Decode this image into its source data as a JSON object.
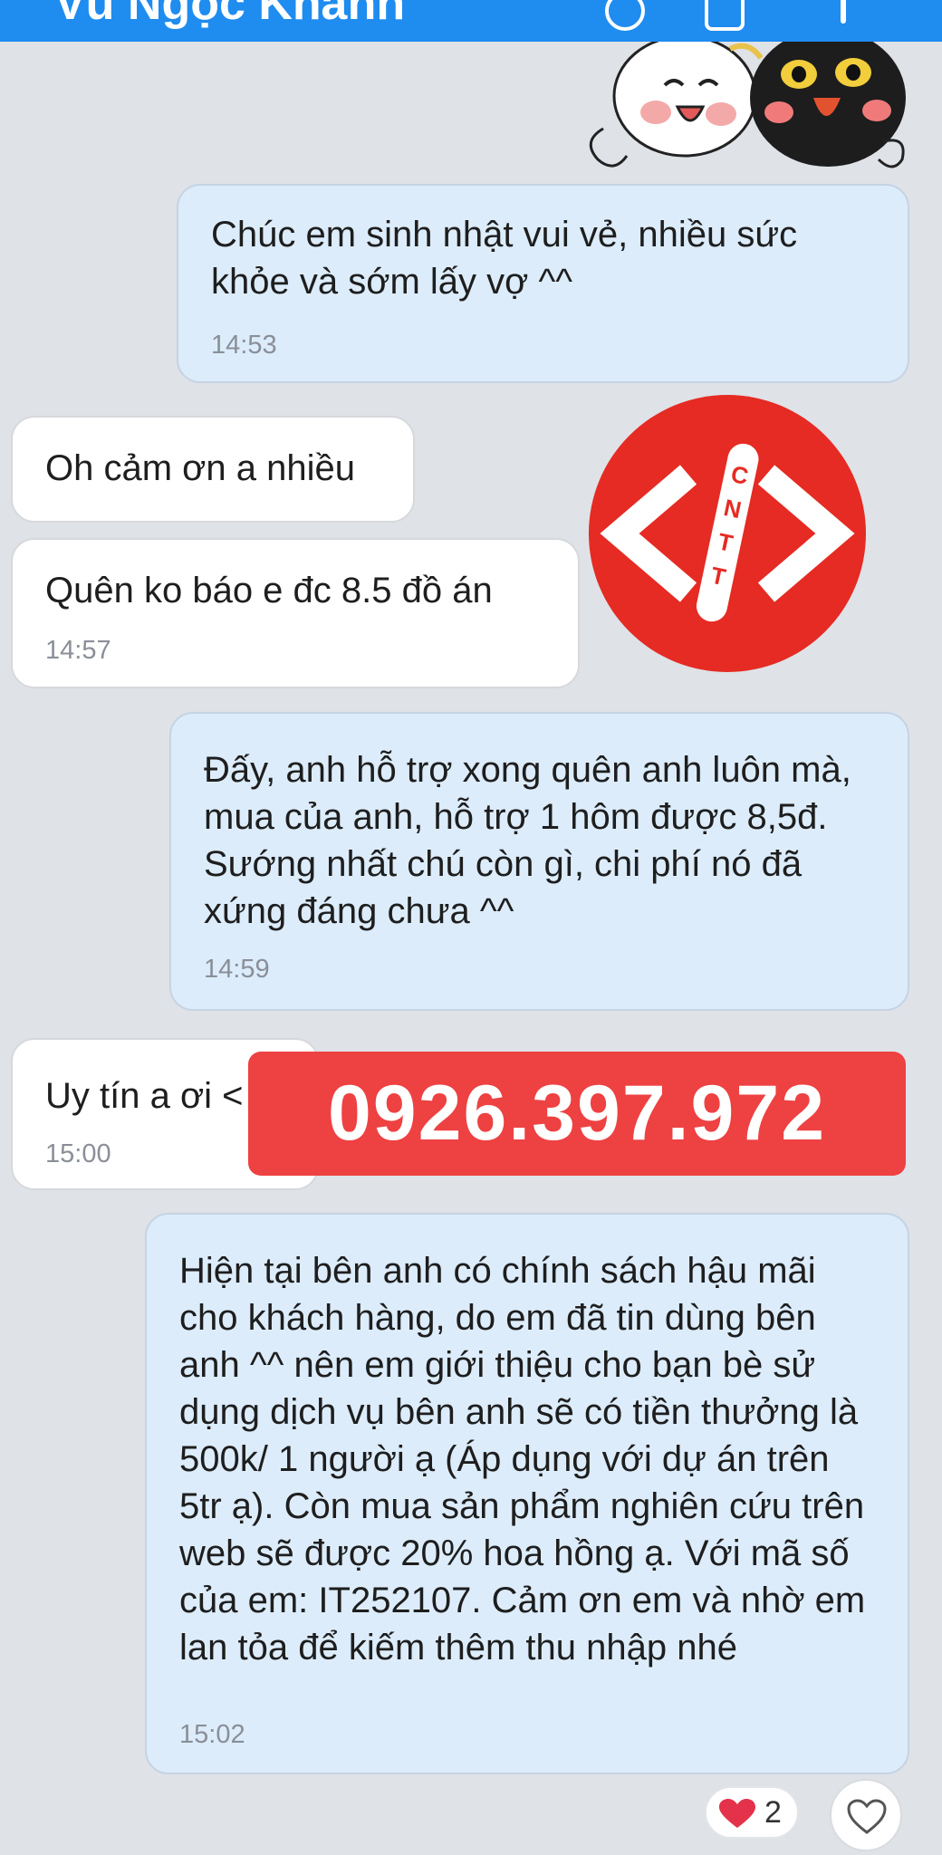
{
  "header": {
    "contact_name": "Vũ Ngọc Khánh"
  },
  "messages": [
    {
      "direction": "out",
      "text": "Chúc em sinh nhật vui vẻ, nhiều sức khỏe và sớm lấy vợ ^^",
      "time": "14:53"
    },
    {
      "direction": "in",
      "text": "Oh cảm ơn a nhiều"
    },
    {
      "direction": "in",
      "text": "Quên ko báo e đc 8.5 đồ án",
      "time": "14:57"
    },
    {
      "direction": "out",
      "text": "Đấy, anh hỗ trợ xong quên anh luôn mà, mua của anh, hỗ trợ 1 hôm được 8,5đ. Sướng nhất chú còn gì, chi phí nó đã xứng đáng chưa ^^",
      "time": "14:59"
    },
    {
      "direction": "in",
      "text": "Uy tín a ơi <",
      "time": "15:00"
    },
    {
      "direction": "out",
      "text": "Hiện tại bên anh có chính sách hậu mãi cho khách hàng, do em đã tin dùng bên anh ^^ nên em giới thiệu cho bạn bè sử dụng dịch vụ bên anh sẽ có tiền thưởng là 500k/ 1 người ạ (Áp dụng với dự án trên 5tr ạ). Còn mua sản phẩm nghiên cứu trên web sẽ được 20% hoa hồng ạ. Với mã số của em: IT252107. Cảm ơn em và nhờ em lan tỏa để kiếm thêm thu nhập nhé",
      "time": "15:02"
    }
  ],
  "overlays": {
    "logo_letters": "CNTT",
    "phone_number": "0926.397.972"
  },
  "reaction": {
    "icon": "heart-icon",
    "count": "2"
  },
  "colors": {
    "header": "#1f8cf0",
    "outgoing_bubble": "#dcecfb",
    "incoming_bubble": "#ffffff",
    "background": "#dfe2e7",
    "accent_red": "#ee4142"
  }
}
